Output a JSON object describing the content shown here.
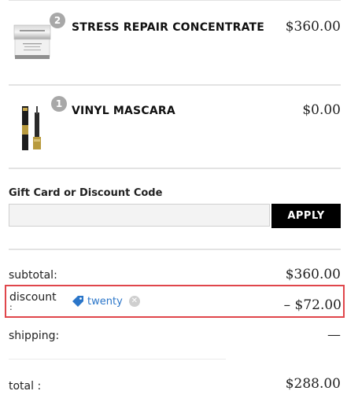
{
  "cart": {
    "items": [
      {
        "name": "STRESS REPAIR CONCENTRATE",
        "quantity": "2",
        "price": "$360.00",
        "image": "cream-jar-image",
        "image_text": "CHANTECAILLE"
      },
      {
        "name": "VINYL MASCARA",
        "quantity": "1",
        "price": "$0.00",
        "image": "mascara-image",
        "image_text": "YSL"
      }
    ]
  },
  "gift": {
    "label": "Gift Card or Discount Code",
    "input_value": "",
    "input_placeholder": "",
    "apply_label": "APPLY"
  },
  "summary": {
    "subtotal_label": "subtotal:",
    "subtotal_value": "$360.00",
    "discount_label": "discount",
    "discount_colon": ":",
    "discount_code": "twenty",
    "discount_icon": "tag-icon",
    "discount_remove_icon": "remove-circle-icon",
    "discount_value": "– $72.00",
    "shipping_label": "shipping:",
    "shipping_value": "—",
    "total_label": "total :",
    "total_value": "$288.00"
  },
  "colors": {
    "highlight_border": "#e0464b",
    "tag_blue": "#2b76c9",
    "apply_bg": "#000000",
    "badge_gray": "#a8a8a8"
  }
}
